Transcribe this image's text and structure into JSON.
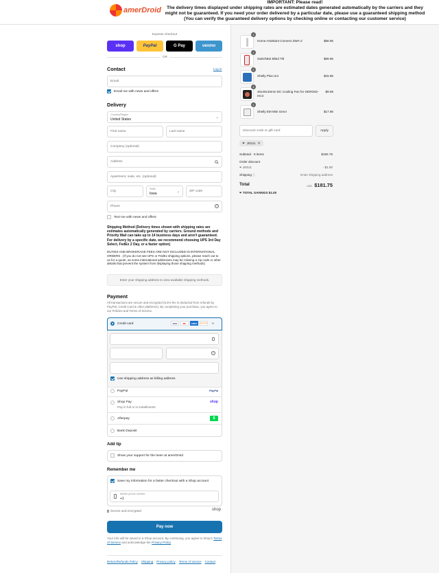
{
  "header": {
    "logo_text": "amerDroid",
    "notice_title": "IMPORTANT: Please read!",
    "notice_body": "The delivery times displayed under shipping rates are estimated dates generated automatically by the carriers and they might not be guaranteed. If you need your order delivered by a particular date, please use a guaranteed shipping method (You can verify the guaranteed delivery options by checking online or contacting our customer service)"
  },
  "express": {
    "label": "Express checkout",
    "buttons": [
      "shop",
      "PayPal",
      "G Pay",
      "venmo"
    ],
    "or": "OR"
  },
  "contact": {
    "title": "Contact",
    "login": "Log in",
    "email_placeholder": "Email",
    "email_news": "Email me with news and offers"
  },
  "delivery": {
    "title": "Delivery",
    "country_label": "Country/Region",
    "country_value": "United States",
    "first_name": "First name",
    "last_name": "Last name",
    "company": "Company (optional)",
    "address": "Address",
    "apartment": "Apartment, suite, etc. (optional)",
    "city": "City",
    "state_label": "State",
    "state_value": "Iowa",
    "zip": "ZIP code",
    "phone": "Phone",
    "text_news": "Text me with news and offers"
  },
  "shipping": {
    "heading": "Shipping Method (Delivery times shown with shipping rates are estimates automatically generated by carriers. Ground methods and Priority Mail can take up to 14 business days and aren't guaranteed. For delivery by a specific date, we recommend choosing UPS 3rd Day Select, FedEx 2 Day, or a faster option)",
    "duties": "DUTIES AND BROKERAGE FEES ARE NOT INCLUDED IN INTERNATIONAL ORDERS . (If you do not see UPS or FedEx shipping options, please reach out to us for a quote, as some international addresses may be missing a zip code or other details that prevent the system from displaying those shipping methods)",
    "placeholder": "Enter your shipping address to view available shipping methods."
  },
  "payment": {
    "title": "Payment",
    "desc": "All transactions are secure and encrypted (5.5% fee is deducted from refunds by PayPal, Credit Card & other platforms). By completing your purchase, you agree to our Policies and Terms of Service.",
    "credit_card": "Credit card",
    "card_brands": [
      "VISA",
      "MC",
      "AMEX",
      "DISCOVER",
      "+5"
    ],
    "billing_same": "Use shipping address as billing address",
    "paypal": "PayPal",
    "paypal_logo": "PayPal",
    "shoppay": "Shop Pay",
    "shoppay_sub": "Pay in full or in installments",
    "shoppay_logo": "shop",
    "afterpay": "Afterpay",
    "bank": "Bank Deposit"
  },
  "tip": {
    "title": "Add tip",
    "option": "Show your support for the team at amerDroid"
  },
  "remember": {
    "title": "Remember me",
    "save": "Save my information for a faster checkout with a Shop account",
    "phone_label": "Mobile phone number",
    "phone_value": "+1",
    "secure": "Secure and encrypted",
    "shop_logo": "shop"
  },
  "paynow": "Pay now",
  "legal": "Your info will be saved to a Shop account. By continuing, you agree to Shop's",
  "legal_terms": "Terms of Service",
  "legal_mid": "and acknowledge the",
  "legal_privacy": "Privacy Policy",
  "footer_links": [
    "Return/Refunds Policy",
    "Shipping",
    "Privacy policy",
    "Terms of service",
    "Contact"
  ],
  "cart": {
    "items": [
      {
        "qty": "1",
        "name": "Home Assistant Connect ZWA-2",
        "price": "$68.95"
      },
      {
        "qty": "1",
        "name": "SwitchBot Blind Tilt",
        "price": "$69.95"
      },
      {
        "qty": "1",
        "name": "Shelly Plus Uni",
        "price": "$15.95"
      },
      {
        "qty": "1",
        "name": "40x40x10mm DC Cooling Fan for ODROID-HC4",
        "price": "$9.95"
      },
      {
        "qty": "1",
        "name": "Shelly EM Mini Gen4",
        "price": "$17.95"
      }
    ],
    "discount_placeholder": "Discount code or gift card",
    "apply": "Apply",
    "code_tag": "JIGU1",
    "subtotal_label": "Subtotal · 5 items",
    "subtotal_value": "$182.75",
    "order_discount": "Order discount",
    "discount_code": "JIGU1",
    "discount_value": "- $1.00",
    "shipping_label": "Shipping",
    "shipping_value": "Enter shipping address",
    "total_label": "Total",
    "currency": "USD",
    "total_value": "$181.75",
    "savings_label": "TOTAL SAVINGS",
    "savings_value": "$1.00"
  }
}
